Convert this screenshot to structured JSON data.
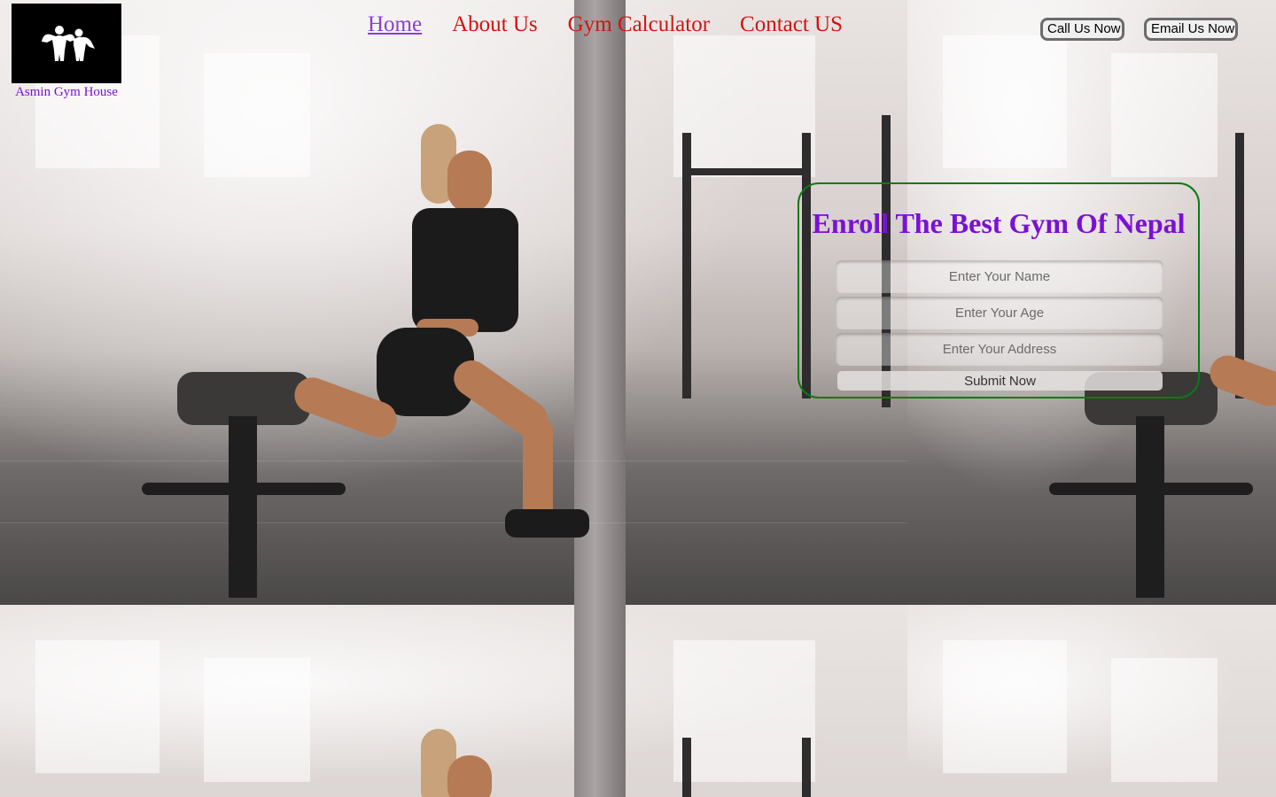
{
  "brand": {
    "name": "Asmin Gym House",
    "logo_icon": "bodybuilders-logo-icon"
  },
  "nav": {
    "items": [
      {
        "label": "Home",
        "active": true
      },
      {
        "label": "About Us",
        "active": false
      },
      {
        "label": "Gym Calculator",
        "active": false
      },
      {
        "label": "Contact US",
        "active": false
      }
    ]
  },
  "header_actions": {
    "call_label": "Call Us Now",
    "email_label": "Email Us Now"
  },
  "enroll": {
    "title": "Enroll The Best Gym Of Nepal",
    "name_placeholder": "Enter Your Name",
    "age_placeholder": "Enter Your Age",
    "address_placeholder": "Enter Your Address",
    "submit_label": "Submit Now"
  },
  "colors": {
    "nav_link": "#d31212",
    "nav_active": "#8a3fd6",
    "brand_text": "#7b10d6",
    "enroll_border": "#0a7a16",
    "enroll_title": "#7b10d6"
  }
}
